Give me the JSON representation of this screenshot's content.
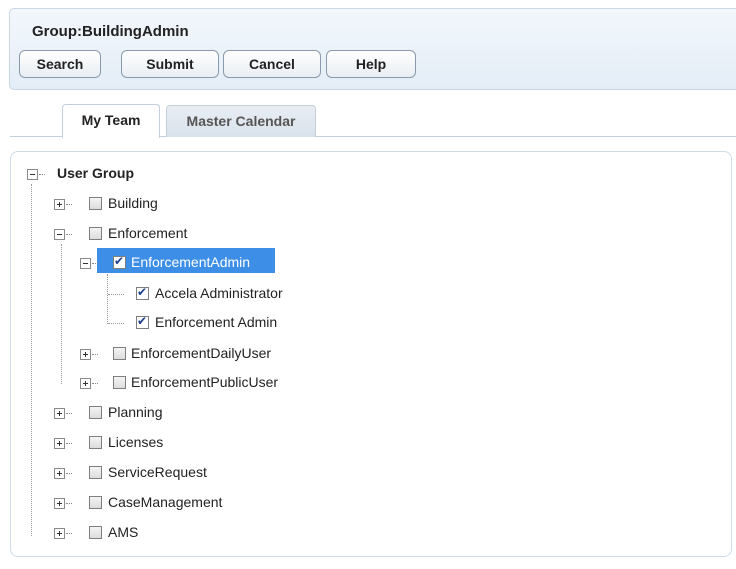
{
  "header": {
    "title": "Group:BuildingAdmin",
    "buttons": {
      "search": "Search",
      "submit": "Submit",
      "cancel": "Cancel",
      "help": "Help"
    }
  },
  "tabs": [
    {
      "label": "My Team",
      "active": true
    },
    {
      "label": "Master Calendar",
      "active": false
    }
  ],
  "tree": {
    "root": {
      "label": "User Group",
      "expanded": true
    },
    "items": [
      {
        "label": "Building",
        "expanded": false,
        "checked": false
      },
      {
        "label": "Enforcement",
        "expanded": true,
        "checked": false
      },
      {
        "label": "EnforcementAdmin",
        "expanded": true,
        "checked": true,
        "selected": true
      },
      {
        "label": "Accela Administrator",
        "checked": true
      },
      {
        "label": "Enforcement Admin",
        "checked": true
      },
      {
        "label": "EnforcementDailyUser",
        "expanded": false,
        "checked": false
      },
      {
        "label": "EnforcementPublicUser",
        "expanded": false,
        "checked": false
      },
      {
        "label": "Planning",
        "expanded": false,
        "checked": false
      },
      {
        "label": "Licenses",
        "expanded": false,
        "checked": false
      },
      {
        "label": "ServiceRequest",
        "expanded": false,
        "checked": false
      },
      {
        "label": "CaseManagement",
        "expanded": false,
        "checked": false
      },
      {
        "label": "AMS",
        "expanded": false,
        "checked": false
      }
    ]
  },
  "colors": {
    "selection": "#3d8ee6",
    "check": "#1b3d8f",
    "header_border": "#c9d7e6"
  }
}
